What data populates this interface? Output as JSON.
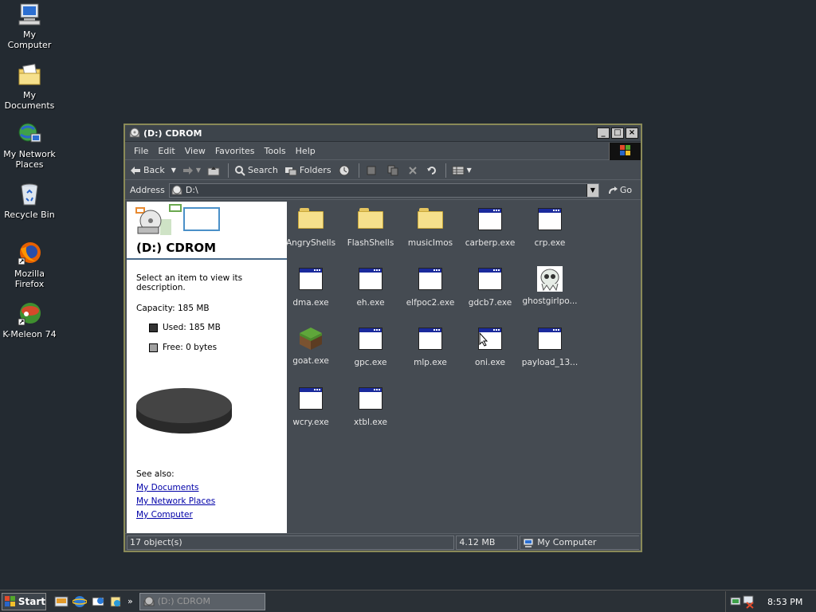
{
  "desktop": {
    "icons": [
      {
        "label": "My Computer"
      },
      {
        "label": "My Documents"
      },
      {
        "label": "My Network Places"
      },
      {
        "label": "Recycle Bin"
      },
      {
        "label": "Mozilla Firefox"
      },
      {
        "label": "K-Meleon 74"
      }
    ]
  },
  "window": {
    "title": "(D:) CDROM",
    "menu": [
      "File",
      "Edit",
      "View",
      "Favorites",
      "Tools",
      "Help"
    ],
    "toolbar": {
      "back": "Back",
      "search": "Search",
      "folders": "Folders"
    },
    "address": {
      "label": "Address",
      "value": "D:\\",
      "go": "Go"
    },
    "taskpane": {
      "title": "(D:) CDROM",
      "description": "Select an item to view its description.",
      "capacity": "Capacity: 185 MB",
      "used": "Used: 185 MB",
      "free": "Free: 0 bytes",
      "used_fraction": 1.0,
      "used_color": "#333333",
      "free_color": "#a0a0a0",
      "see_also": "See also:",
      "links": [
        "My Documents",
        "My Network Places",
        "My Computer"
      ]
    },
    "files": [
      {
        "name": "AngryShells",
        "type": "folder"
      },
      {
        "name": "FlashShells",
        "type": "folder"
      },
      {
        "name": "musicImos",
        "type": "folder"
      },
      {
        "name": "carberp.exe",
        "type": "exe"
      },
      {
        "name": "crp.exe",
        "type": "exe"
      },
      {
        "name": "dma.exe",
        "type": "exe"
      },
      {
        "name": "eh.exe",
        "type": "exe"
      },
      {
        "name": "elfpoc2.exe",
        "type": "exe"
      },
      {
        "name": "gdcb7.exe",
        "type": "exe"
      },
      {
        "name": "ghostgirlpo...",
        "type": "ghost"
      },
      {
        "name": "goat.exe",
        "type": "goat"
      },
      {
        "name": "gpc.exe",
        "type": "exe"
      },
      {
        "name": "mlp.exe",
        "type": "exe"
      },
      {
        "name": "oni.exe",
        "type": "exe"
      },
      {
        "name": "payload_13...",
        "type": "exe"
      },
      {
        "name": "wcry.exe",
        "type": "exe"
      },
      {
        "name": "xtbl.exe",
        "type": "exe"
      }
    ],
    "status": {
      "objects": "17 object(s)",
      "size": "4.12 MB",
      "zone": "My Computer"
    }
  },
  "taskbar": {
    "start": "Start",
    "task": "(D:) CDROM",
    "clock": "8:53 PM"
  }
}
